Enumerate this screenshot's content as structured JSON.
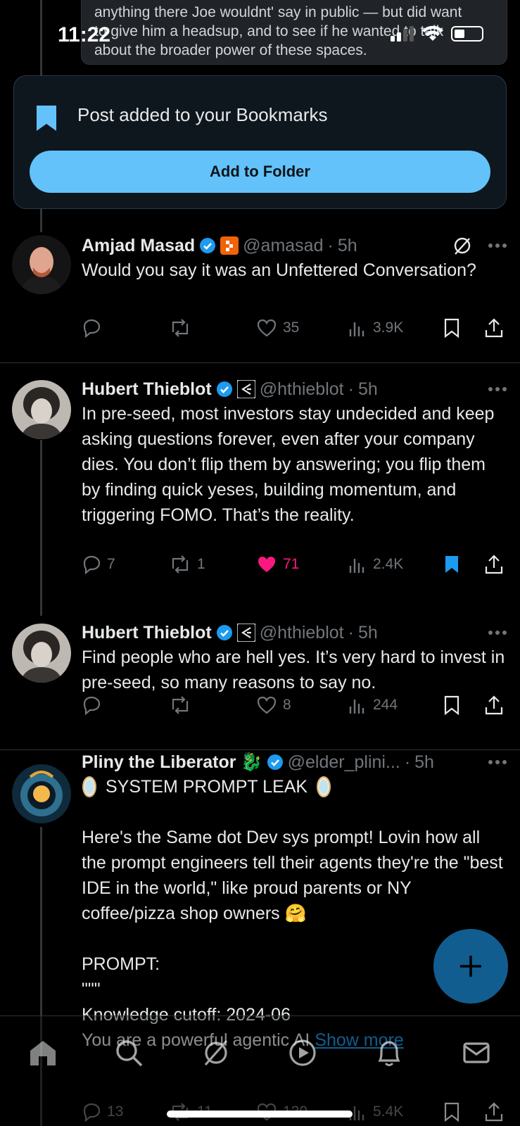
{
  "status_bar": {
    "time": "11:22"
  },
  "quote_fragment": {
    "lines": [
      "anything there Joe wouldnt' say in public — but did want",
      "to give him a headsup, and to see if he wanted to talk",
      "about the broader power of these spaces."
    ]
  },
  "toast": {
    "message": "Post added to your Bookmarks",
    "button_label": "Add to Folder"
  },
  "posts": [
    {
      "name": "Amjad Masad",
      "handle": "@amasad",
      "time": "5h",
      "text": "Would you say it was an Unfettered Conversation?",
      "replies": "",
      "reposts": "",
      "likes": "35",
      "views": "3.9K"
    },
    {
      "name": "Hubert Thieblot",
      "handle": "@hthieblot",
      "time": "5h",
      "text": "In pre-seed, most investors stay undecided and keep asking questions forever, even after your company dies. You don’t flip them by answering; you flip them by finding quick yeses, building momentum, and triggering FOMO. That’s the reality.",
      "replies": "7",
      "reposts": "1",
      "likes": "71",
      "views": "2.4K"
    },
    {
      "name": "Hubert Thieblot",
      "handle": "@hthieblot",
      "time": "5h",
      "text": "Find people who are hell yes. It’s very hard to invest in pre-seed, so many reasons to say no.",
      "replies": "",
      "reposts": "",
      "likes": "8",
      "views": "244"
    },
    {
      "name": "Pliny the Liberator",
      "name_emoji": "🐉",
      "handle": "@elder_plini...",
      "time": "5h",
      "title": "SYSTEM PROMPT LEAK",
      "text": "Here's the Same dot Dev sys prompt! Lovin how all the prompt engineers tell their agents they're the \"best IDE in the world,\" like proud parents or NY coffee/pizza shop owners 🤗\n\nPROMPT:\n\"\"\"\nKnowledge cutoff: 2024-06\n",
      "last_line": "You are a powerful agentic AI",
      "show_more": "Show more",
      "replies": "13",
      "reposts": "11",
      "likes": "120",
      "views": "5.4K"
    }
  ],
  "colors": {
    "accent": "#1d9bf0",
    "like": "#f91880",
    "muted": "#71767b",
    "toast_button": "#63c2f9"
  }
}
